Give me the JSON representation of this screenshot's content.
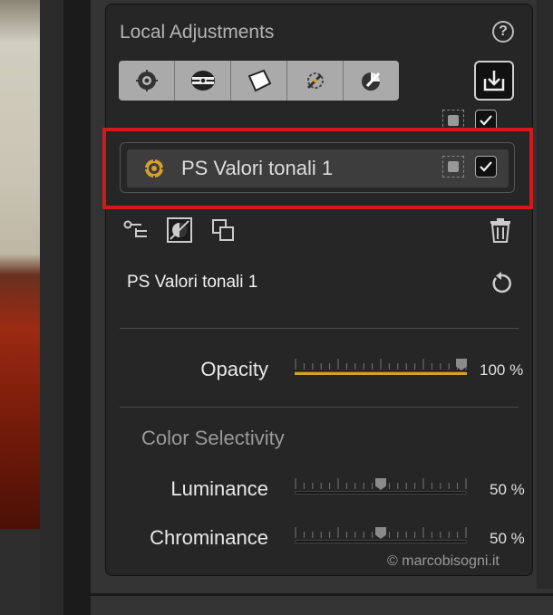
{
  "panel": {
    "title": "Local Adjustments",
    "help_label": "?"
  },
  "toolbar": {
    "tools": [
      {
        "icon": "control-point-icon"
      },
      {
        "icon": "gradient-icon"
      },
      {
        "icon": "polygon-lasso-icon"
      },
      {
        "icon": "brush-icon"
      },
      {
        "icon": "color-picker-icon"
      }
    ],
    "save_icon": "save-download-icon"
  },
  "layer": {
    "name": "PS Valori tonali 1",
    "icon": "control-point-icon",
    "enabled": true
  },
  "section": {
    "layer_title": "PS Valori tonali 1",
    "opacity_label": "Opacity",
    "opacity_value": "100 %",
    "opacity": 1.0,
    "color_selectivity_title": "Color Selectivity",
    "luminance_label": "Luminance",
    "luminance_value": "50 %",
    "luminance": 0.5,
    "chrominance_label": "Chrominance",
    "chrominance_value": "50 %",
    "chrominance": 0.5
  },
  "watermark": "© marcobisogni.it",
  "colors": {
    "accent": "#d4a12a",
    "highlight_frame": "#d21a1a"
  }
}
